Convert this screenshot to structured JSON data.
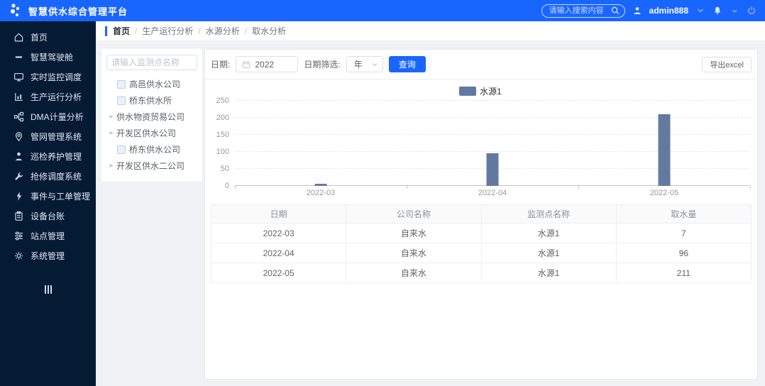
{
  "header": {
    "app_title": "智慧供水综合管理平台",
    "search_placeholder": "请输入搜索内容",
    "username": "admin888"
  },
  "sidebar": {
    "items": [
      {
        "label": "首页",
        "icon": "home-icon"
      },
      {
        "label": "智慧驾驶舱",
        "icon": "cockpit-icon"
      },
      {
        "label": "实时监控调度",
        "icon": "monitor-icon"
      },
      {
        "label": "生产运行分析",
        "icon": "analysis-icon"
      },
      {
        "label": "DMA计量分析",
        "icon": "dma-icon"
      },
      {
        "label": "管网管理系统",
        "icon": "pipe-network-icon"
      },
      {
        "label": "巡检养护管理",
        "icon": "inspection-icon"
      },
      {
        "label": "抢修调度系统",
        "icon": "repair-icon"
      },
      {
        "label": "事件与工单管理",
        "icon": "workorder-icon"
      },
      {
        "label": "设备台账",
        "icon": "equipment-icon"
      },
      {
        "label": "站点管理",
        "icon": "station-icon"
      },
      {
        "label": "系统管理",
        "icon": "system-icon"
      }
    ]
  },
  "breadcrumb": {
    "separator": "/",
    "items": [
      "首页",
      "生产运行分析",
      "水源分析",
      "取水分析"
    ]
  },
  "tree_panel": {
    "search_placeholder": "请输入监测点名称",
    "items": [
      {
        "label": "高邑供水公司",
        "type": "checkbox"
      },
      {
        "label": "桥东供水所",
        "type": "checkbox"
      },
      {
        "label": "供水物资贸易公司",
        "type": "expand"
      },
      {
        "label": "开发区供水公司",
        "type": "expand"
      },
      {
        "label": "桥东供水公司",
        "type": "checkbox"
      },
      {
        "label": "开发区供水二公司",
        "type": "expand"
      }
    ]
  },
  "filters": {
    "date_label": "日期:",
    "date_value": "2022",
    "filter_label": "日期筛选:",
    "filter_value": "年",
    "query_button": "查询",
    "export_button": "导出excel"
  },
  "chart_data": {
    "type": "bar",
    "title": "",
    "xlabel": "",
    "ylabel": "",
    "legend": [
      "水源1"
    ],
    "legend_position": "top-center",
    "categories": [
      "2022-03",
      "2022-04",
      "2022-05"
    ],
    "series": [
      {
        "name": "水源1",
        "values": [
          7,
          96,
          211
        ]
      }
    ],
    "ylim": [
      0,
      250
    ],
    "yticks": [
      0,
      50,
      100,
      150,
      200,
      250
    ],
    "grid": true,
    "bar_color": "#627aa0"
  },
  "table": {
    "columns": [
      "日期",
      "公司名称",
      "监测点名称",
      "取水量"
    ],
    "rows": [
      [
        "2022-03",
        "自来水",
        "水源1",
        "7"
      ],
      [
        "2022-04",
        "自来水",
        "水源1",
        "96"
      ],
      [
        "2022-05",
        "自来水",
        "水源1",
        "211"
      ]
    ]
  },
  "colors": {
    "header_bg": "#1966ff",
    "sidebar_bg": "#051a33",
    "accent": "#1966ff",
    "bar": "#627aa0"
  }
}
